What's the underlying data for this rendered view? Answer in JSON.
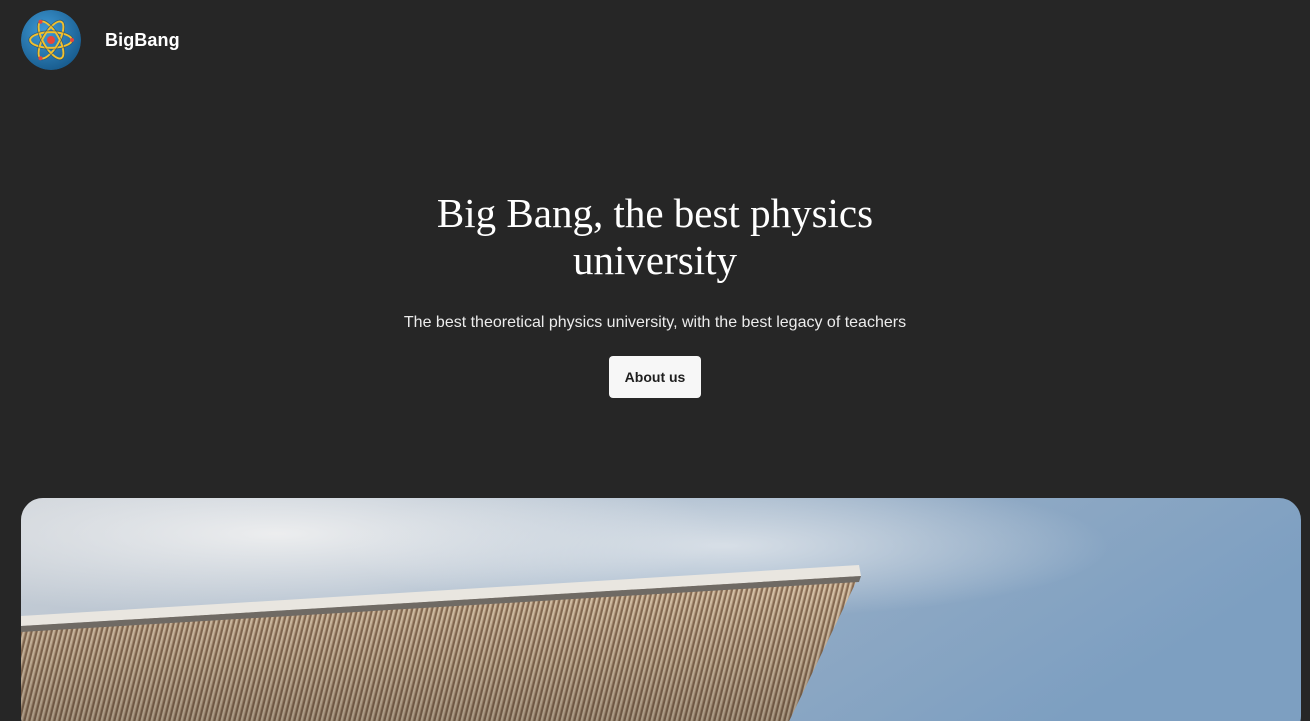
{
  "header": {
    "logo_icon": "atom-icon",
    "site_name": "BigBang"
  },
  "hero": {
    "title": "Big Bang, the best physics university",
    "subtitle": "The best theoretical physics university, with the best legacy of teachers",
    "cta_label": "About us"
  },
  "banner": {
    "image": "building-roof-photo"
  },
  "colors": {
    "background": "#262626",
    "text": "#ffffff",
    "button_bg": "#f7f7f7",
    "button_text": "#1e1e1e",
    "logo_blue": "#1f6fa8",
    "logo_orbit": "#f2c12e"
  }
}
